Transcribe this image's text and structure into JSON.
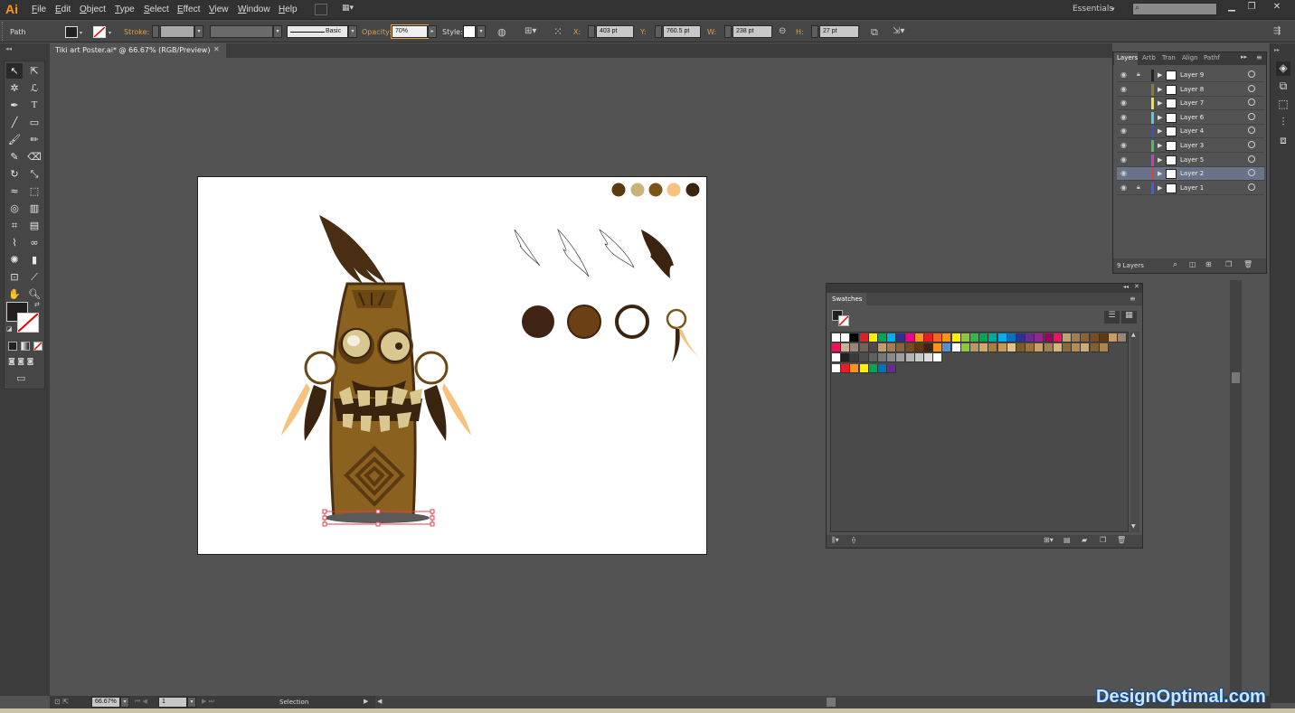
{
  "app": {
    "logo": "Ai"
  },
  "menu": [
    "File",
    "Edit",
    "Object",
    "Type",
    "Select",
    "Effect",
    "View",
    "Window",
    "Help"
  ],
  "workspace": {
    "label": "Essentials",
    "search_placeholder": ""
  },
  "control": {
    "selection": "Path",
    "stroke_label": "Stroke:",
    "brush": "Basic",
    "opacity_label": "Opacity:",
    "opacity": "70%",
    "style_label": "Style:",
    "x_label": "X:",
    "x": "403 pt",
    "y_label": "Y:",
    "y": "760.5 pt",
    "w_label": "W:",
    "w": "238 pt",
    "h_label": "H:",
    "h": "27 pt"
  },
  "document": {
    "tab": "Tiki art Poster.ai* @ 66.67% (RGB/Preview)"
  },
  "layers": {
    "tabs": [
      "Layers",
      "Artb",
      "Tran",
      "Align",
      "Pathf"
    ],
    "rows": [
      {
        "name": "Layer 9",
        "color": "#222222",
        "locked": true
      },
      {
        "name": "Layer 8",
        "color": "#8a7a3a",
        "locked": false
      },
      {
        "name": "Layer 7",
        "color": "#f0e040",
        "locked": false
      },
      {
        "name": "Layer 6",
        "color": "#50d0d0",
        "locked": false
      },
      {
        "name": "Layer 4",
        "color": "#4050c0",
        "locked": false
      },
      {
        "name": "Layer 3",
        "color": "#50c050",
        "locked": false
      },
      {
        "name": "Layer 5",
        "color": "#c040c0",
        "locked": false
      },
      {
        "name": "Layer 2",
        "color": "#e04040",
        "locked": false,
        "selected": true
      },
      {
        "name": "Layer 1",
        "color": "#4060e0",
        "locked": true
      }
    ],
    "count": "9 Layers"
  },
  "swatches": {
    "title": "Swatches"
  },
  "status": {
    "zoom": "66.67%",
    "page": "1",
    "tool": "Selection"
  },
  "artboard": {
    "palette": [
      "#5a3a12",
      "#c8b47a",
      "#7a5418",
      "#f7c27e",
      "#3a2410"
    ]
  },
  "watermark": "DesignOptimal.com"
}
